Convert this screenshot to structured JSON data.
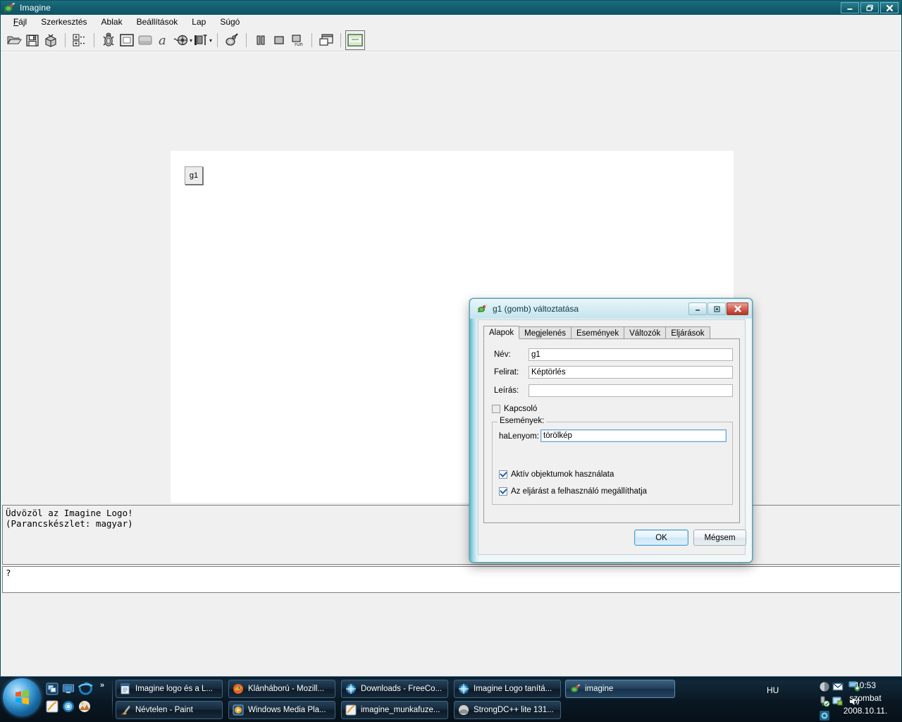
{
  "app": {
    "title": "Imagine",
    "titlebar_icon": "imagine-logo-icon",
    "window_buttons": {
      "minimize": "_",
      "restore": "❐",
      "close": "✕"
    }
  },
  "menu": [
    {
      "label": "Fájl",
      "accel": "F"
    },
    {
      "label": "Szerkesztés",
      "accel": "S"
    },
    {
      "label": "Ablak",
      "accel": "A"
    },
    {
      "label": "Beállítások",
      "accel": "B"
    },
    {
      "label": "Lap",
      "accel": "L"
    },
    {
      "label": "Súgó",
      "accel": "S"
    }
  ],
  "toolbar": {
    "items": [
      {
        "name": "open-icon",
        "title": "Megnyitás"
      },
      {
        "name": "save-icon",
        "title": "Mentés"
      },
      {
        "name": "package-icon",
        "title": "Csomag"
      },
      {
        "sep": true
      },
      {
        "name": "pages-list-icon",
        "title": "Lapok"
      },
      {
        "sep": true
      },
      {
        "name": "turtle-icon",
        "title": "Teknőc"
      },
      {
        "name": "button-object-icon",
        "title": "Gomb"
      },
      {
        "name": "panel-object-icon",
        "title": "Mező"
      },
      {
        "name": "text-object-icon",
        "title": "Szöveg"
      },
      {
        "name": "media-object-icon",
        "title": "Média",
        "caret": true
      },
      {
        "name": "slider-object-icon",
        "title": "Csúszka",
        "caret": true
      },
      {
        "sep": true
      },
      {
        "name": "logo-paint-icon",
        "title": "Rajz"
      },
      {
        "sep": true
      },
      {
        "name": "pause-icon",
        "title": "Szünet"
      },
      {
        "name": "stop-icon",
        "title": "Leállítás"
      },
      {
        "name": "run-icon",
        "title": "Futtatás"
      },
      {
        "sep": true
      },
      {
        "name": "window-icon",
        "title": "Ablak"
      },
      {
        "sep": true
      },
      {
        "name": "memo-icon",
        "title": "Memó"
      }
    ]
  },
  "canvas": {
    "button_label": "g1",
    "turtle_icon": "turtle-icon"
  },
  "log": {
    "lines": [
      "Üdvözöl az Imagine Logo!",
      "(Parancskészlet: magyar)"
    ],
    "command_prompt": "?"
  },
  "dialog": {
    "title": "g1 (gomb) változtatása",
    "icon": "imagine-logo-icon",
    "window_buttons": {
      "minimize": "_",
      "restore": "❐",
      "close": "✕"
    },
    "tabs": [
      {
        "label": "Alapok",
        "active": true
      },
      {
        "label": "Megjelenés",
        "active": false
      },
      {
        "label": "Események",
        "active": false
      },
      {
        "label": "Változók",
        "active": false
      },
      {
        "label": "Eljárások",
        "active": false
      }
    ],
    "fields": {
      "name_label": "Név:",
      "name_value": "g1",
      "caption_label": "Felirat:",
      "caption_value": "Képtörlés",
      "description_label": "Leírás:",
      "description_value": ""
    },
    "switch_checkbox": {
      "label": "Kapcsoló",
      "checked": false
    },
    "events_group": {
      "title": "Események:",
      "onpress_label": "haLenyom:",
      "onpress_value": "törölkép",
      "checkboxes": [
        {
          "label": "Aktív objektumok használata",
          "checked": true
        },
        {
          "label": "Az eljárást a felhasználó megállíthatja",
          "checked": true
        }
      ]
    },
    "buttons": {
      "ok": "OK",
      "cancel": "Mégsem"
    }
  },
  "taskbar": {
    "start_icon": "windows-start-orb-icon",
    "quicklaunch": [
      {
        "name": "show-desktop-switch-icon"
      },
      {
        "name": "show-desktop-icon"
      },
      {
        "name": "internet-explorer-icon"
      },
      {
        "name": "imagine-quick-icon"
      },
      {
        "name": "media-center-icon"
      },
      {
        "name": "photo-gallery-icon"
      }
    ],
    "quicklaunch_chevron": "»",
    "tasks_row1": [
      {
        "label": "Imagine logo és a L...",
        "icon": "word-document-icon",
        "active": false
      },
      {
        "label": "Klánháború - Mozill...",
        "icon": "firefox-icon",
        "active": false
      },
      {
        "label": "Downloads - FreeCo...",
        "icon": "browser-globe-icon",
        "active": false
      },
      {
        "label": "Imagine Logo tanítá...",
        "icon": "browser-globe-icon",
        "active": false
      }
    ],
    "tasks_row2": [
      {
        "label": "Névtelen - Paint",
        "icon": "paint-icon",
        "active": false
      },
      {
        "label": "Windows Media Pla...",
        "icon": "wmp-icon",
        "active": false
      },
      {
        "label": "imagine_munkafuze...",
        "icon": "imagine-doc-icon",
        "active": false
      },
      {
        "label": "StrongDC++ lite 131...",
        "icon": "strongdc-icon",
        "active": false
      }
    ],
    "task_active": {
      "label": "imagine",
      "icon": "imagine-logo-icon",
      "active": true
    },
    "tray": {
      "language": "HU",
      "icons": [
        {
          "name": "volume-disk-icon"
        },
        {
          "name": "mail-icon"
        },
        {
          "name": "network-icon"
        },
        {
          "name": "usb-safe-remove-icon"
        },
        {
          "name": "taskmanager-icon"
        },
        {
          "name": "speaker-icon"
        },
        {
          "name": "antivirus-icon"
        }
      ]
    },
    "clock": {
      "time": "10:53",
      "day": "szombat",
      "date": "2008.10.11."
    }
  },
  "colors": {
    "title_bar": "#135f70",
    "dialog_frame": "#5fb8cb",
    "accent_blue": "#4f9fd0",
    "taskbar": "#0a1722"
  }
}
